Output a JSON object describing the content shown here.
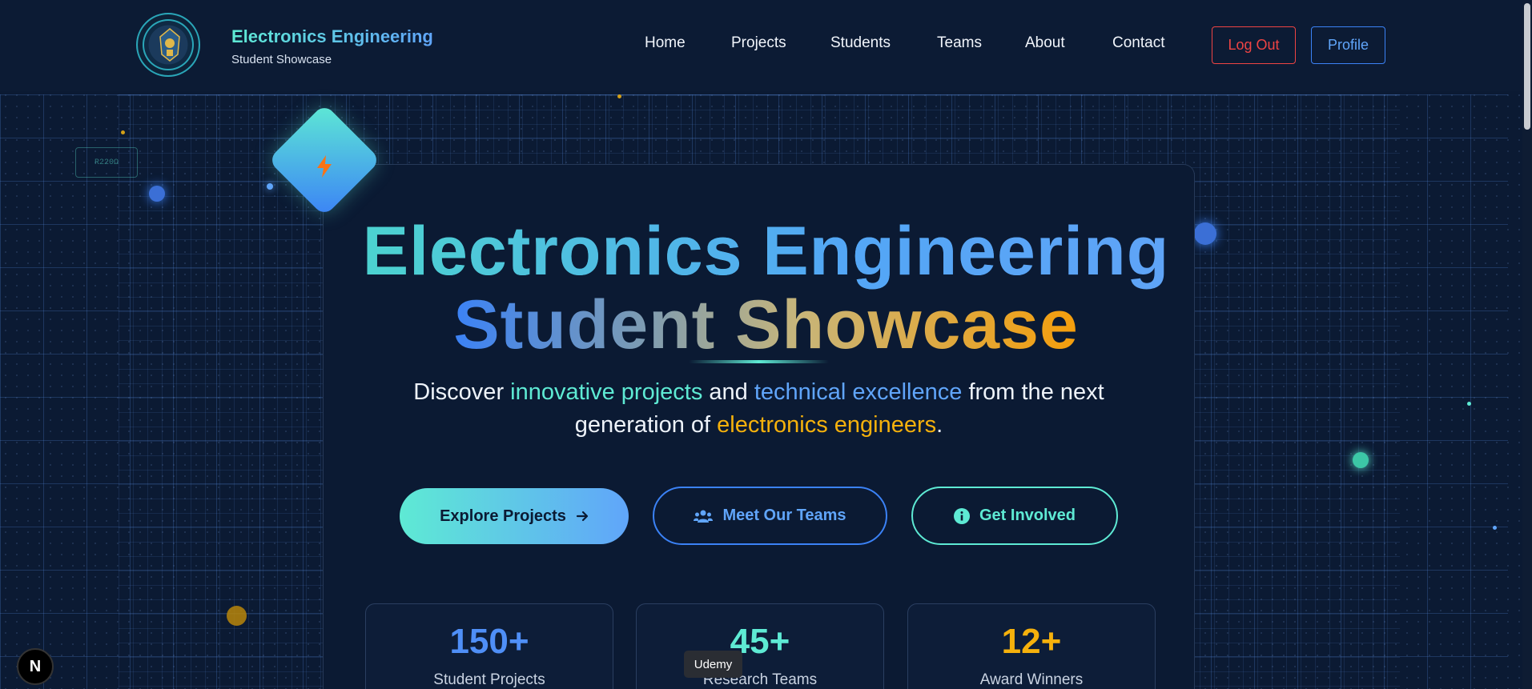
{
  "header": {
    "brand_title": "Electronics Engineering",
    "brand_subtitle": "Student Showcase",
    "nav": [
      "Home",
      "Projects",
      "Students",
      "Teams",
      "About",
      "Contact"
    ],
    "logout_label": "Log Out",
    "profile_label": "Profile"
  },
  "hero": {
    "title_line1": "Electronics Engineering",
    "title_line2": "Student Showcase",
    "subtitle_parts": {
      "p1": "Discover ",
      "h1": "innovative projects",
      "p2": " and ",
      "h2": "technical excellence",
      "p3": " from the next generation of ",
      "h3": "electronics engineers",
      "p4": "."
    },
    "buttons": {
      "explore": "Explore Projects",
      "teams": "Meet Our Teams",
      "involved": "Get Involved"
    }
  },
  "stats": [
    {
      "value": "150+",
      "label": "Student Projects",
      "color": "#4f8ff7"
    },
    {
      "value": "45+",
      "label": "Research Teams",
      "color": "#5eead4"
    },
    {
      "value": "12+",
      "label": "Award Winners",
      "color": "#f5b10c"
    }
  ],
  "decor": {
    "chip_label": "R220Ω"
  },
  "tooltip": "Udemy",
  "dev_badge": "N",
  "colors": {
    "background": "#0b1a33",
    "teal": "#5eead4",
    "blue": "#60a5fa",
    "amber": "#f5b10c",
    "danger": "#ef4444"
  }
}
